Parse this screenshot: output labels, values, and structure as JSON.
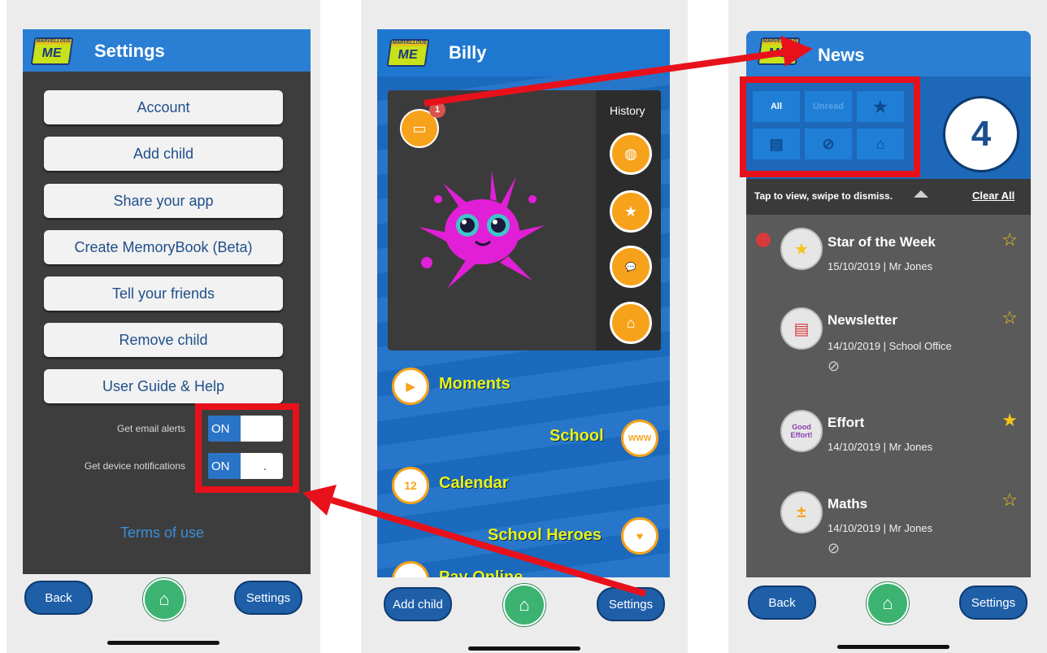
{
  "colors": {
    "accent_blue": "#2a7fd4",
    "annotation_red": "#e8111b",
    "brand_yellow": "#e8f21a",
    "orange": "#f7a21b",
    "home_green": "#3cb371"
  },
  "logo": {
    "top": "MARVELLOUS",
    "main": "ME"
  },
  "settings_screen": {
    "title": "Settings",
    "buttons": [
      "Account",
      "Add child",
      "Share your app",
      "Create MemoryBook (Beta)",
      "Tell your friends",
      "Remove child",
      "User Guide & Help"
    ],
    "email_alerts_label": "Get email alerts",
    "email_alerts_value": "ON",
    "device_notifications_label": "Get device notifications",
    "device_notifications_value": "ON",
    "device_notifications_knob": ".",
    "terms_link": "Terms of use",
    "nav": {
      "back": "Back",
      "settings": "Settings",
      "home_icon": "home-icon"
    }
  },
  "child_screen": {
    "title": "Billy",
    "inbox_badge": "1",
    "history_label": "History",
    "history_icons": [
      "globe-icon",
      "star-me-icon",
      "hello-icon",
      "house-check-icon"
    ],
    "menu": [
      {
        "label": "Moments",
        "icon": "moments-icon",
        "side": "left"
      },
      {
        "label": "School",
        "icon": "www-icon",
        "icon_text": "WWW",
        "side": "right"
      },
      {
        "label": "Calendar",
        "icon": "calendar-icon",
        "icon_text": "12",
        "side": "left"
      },
      {
        "label": "School Heroes",
        "icon": "heart-icon",
        "side": "right"
      },
      {
        "label": "Pay Online",
        "icon": "pay-icon",
        "side": "left"
      }
    ],
    "nav": {
      "add_child": "Add child",
      "settings": "Settings",
      "home_icon": "home-icon"
    }
  },
  "news_screen": {
    "title": "News",
    "filters": [
      {
        "label": "All",
        "icon": ""
      },
      {
        "label": "Unread",
        "icon": ""
      },
      {
        "label": "",
        "icon": "star-filter-icon"
      },
      {
        "label": "",
        "icon": "document-filter-icon"
      },
      {
        "label": "",
        "icon": "paperclip-filter-icon"
      },
      {
        "label": "",
        "icon": "home-filter-icon"
      }
    ],
    "count": "4",
    "hint": "Tap to view, swipe to dismiss.",
    "clear_all": "Clear All",
    "items": [
      {
        "title": "Star of the Week",
        "meta": "15/10/2019 | Mr Jones",
        "unread": true,
        "starred": false,
        "attachment": false,
        "icon": "star-award-icon"
      },
      {
        "title": "Newsletter",
        "meta": "14/10/2019 | School Office",
        "unread": false,
        "starred": false,
        "attachment": true,
        "icon": "newsletter-icon"
      },
      {
        "title": "Effort",
        "meta": "14/10/2019 | Mr Jones",
        "unread": false,
        "starred": true,
        "attachment": false,
        "icon": "good-effort-icon"
      },
      {
        "title": "Maths",
        "meta": "14/10/2019 | Mr Jones",
        "unread": false,
        "starred": false,
        "attachment": true,
        "icon": "maths-icon"
      }
    ],
    "effort_icon_text": "Good Effort!",
    "nav": {
      "back": "Back",
      "settings": "Settings",
      "home_icon": "home-icon"
    }
  }
}
